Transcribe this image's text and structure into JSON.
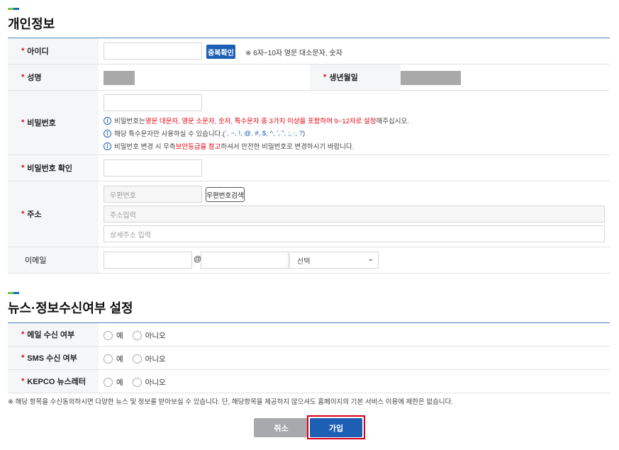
{
  "personal": {
    "title": "개인정보",
    "id_label": "아이디",
    "dup_check_button": "중복확인",
    "id_hint": "※ 6자~10자 영문 대소문자, 숫자",
    "name_label": "성명",
    "birth_label": "생년월일",
    "password_label": "비밀번호",
    "pw_note1": {
      "a": "비밀번호는 ",
      "b": "영문 대문자, 영문 소문자, 숫자, 특수문자 중 3가지 이상을 포함하여 9~12자로 설정",
      "c": "해주십시오."
    },
    "pw_note2": {
      "a": "해당 특수문자만 사용하실 수 있습니다.( ",
      "b": "`, ~, !, @, #, $, ^, ', \", ;, :, ?",
      "c": ")"
    },
    "pw_note3": {
      "a": "비밀번호 변경 시 우측 ",
      "b": "보안등급을 참고",
      "c": "하셔서 안전한 비밀번호로 변경하시기 바랍니다."
    },
    "password_confirm_label": "비밀번호 확인",
    "address_label": "주소",
    "zip_placeholder": "우편번호",
    "zip_search_button": "우편번호검색",
    "address_placeholder": "주소입력",
    "address_detail_placeholder": "상세주소 입력",
    "email_label": "이메일",
    "email_at": "@",
    "email_domain_selected": "선택"
  },
  "news": {
    "title": "뉴스·정보수신여부 설정",
    "rows": [
      {
        "label": "메일 수신 여부",
        "yes": "예",
        "no": "아니오"
      },
      {
        "label": "SMS 수신 여부",
        "yes": "예",
        "no": "아니오"
      },
      {
        "label": "KEPCO 뉴스레터",
        "yes": "예",
        "no": "아니오"
      }
    ],
    "footer_note": "※ 해당 항목을 수신동의하시면 다양한 뉴스 및 정보를 받아보실 수 있습니다. 단, 해당항목을 제공하지 않으셔도 홈페이지의 기본 서비스 이용에 제한은 없습니다."
  },
  "actions": {
    "cancel": "취소",
    "join": "가입"
  },
  "required_mark": "*",
  "info_icon_glyph": "i",
  "select_chevron_glyph": "⌄",
  "colors": {
    "accent_blue": "#1c5fb4",
    "required_red": "#e60012",
    "highlight_outline": "#d9001b"
  }
}
